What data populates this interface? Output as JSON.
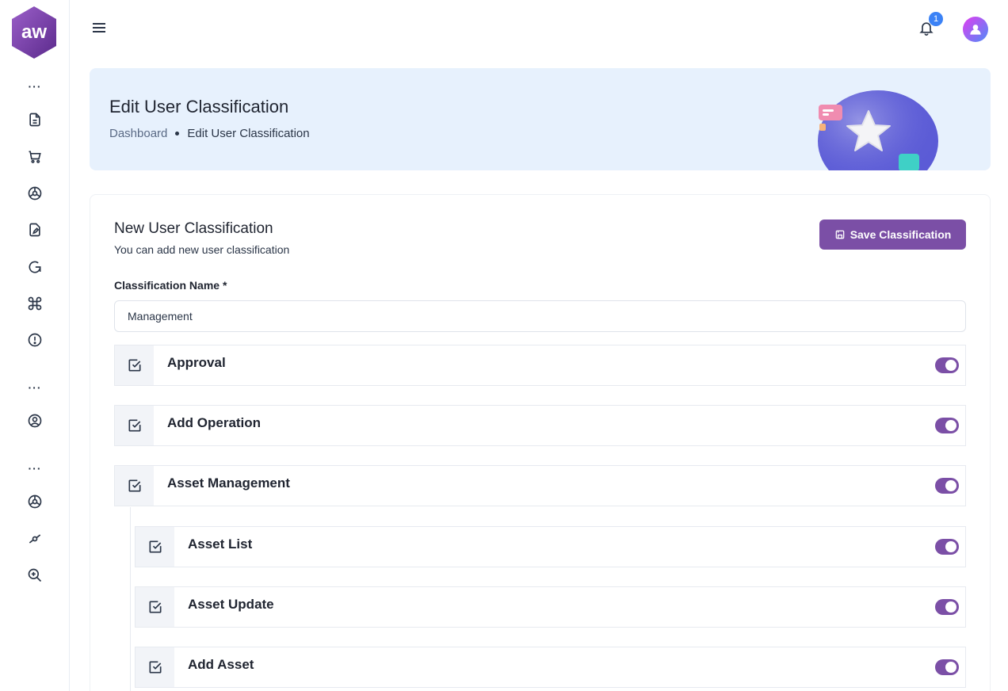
{
  "app": {
    "logo_text": "aw"
  },
  "header": {
    "notification_count": "1"
  },
  "banner": {
    "title": "Edit User Classification",
    "breadcrumb": {
      "home": "Dashboard",
      "current": "Edit User Classification"
    }
  },
  "form": {
    "title": "New User Classification",
    "subtitle": "You can add new user classification",
    "save_label": "Save Classification",
    "name_label": "Classification Name *",
    "name_value": "Management"
  },
  "permissions": [
    {
      "label": "Approval",
      "enabled": true,
      "checked": true,
      "level": 0
    },
    {
      "label": "Add Operation",
      "enabled": true,
      "checked": true,
      "level": 0
    },
    {
      "label": "Asset Management",
      "enabled": true,
      "checked": true,
      "level": 0
    },
    {
      "label": "Asset List",
      "enabled": true,
      "checked": true,
      "level": 1
    },
    {
      "label": "Asset Update",
      "enabled": true,
      "checked": true,
      "level": 1
    },
    {
      "label": "Add Asset",
      "enabled": true,
      "checked": true,
      "level": 1
    }
  ],
  "colors": {
    "accent": "#7b4fa6",
    "banner_bg": "#e7f1fd",
    "badge": "#3b82f6"
  }
}
